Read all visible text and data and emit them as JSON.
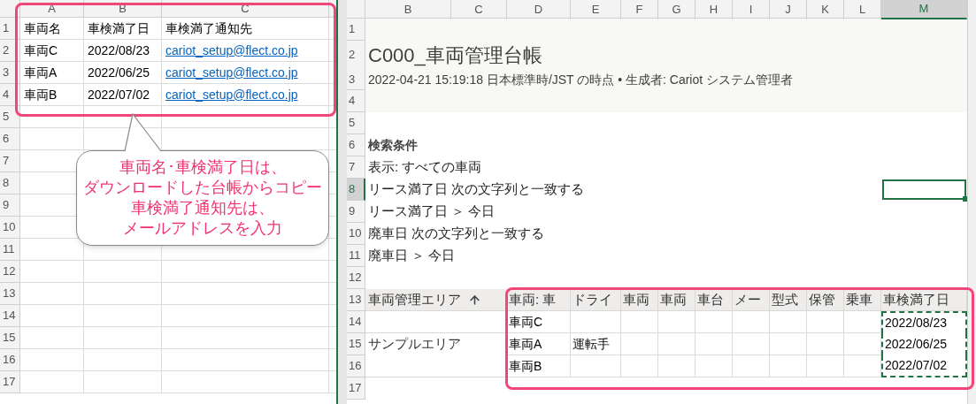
{
  "left_sheet": {
    "columns": [
      "A",
      "B",
      "C"
    ],
    "rows": [
      {
        "number": "1",
        "cells": [
          {
            "text": "車両名",
            "kind": "text"
          },
          {
            "text": "車検満了日",
            "kind": "text"
          },
          {
            "text": "車検満了通知先",
            "kind": "text"
          }
        ]
      },
      {
        "number": "2",
        "cells": [
          {
            "text": "車両C",
            "kind": "text"
          },
          {
            "text": "2022/08/23",
            "kind": "text"
          },
          {
            "text": "cariot_setup@flect.co.jp",
            "kind": "link"
          }
        ]
      },
      {
        "number": "3",
        "cells": [
          {
            "text": "車両A",
            "kind": "text"
          },
          {
            "text": "2022/06/25",
            "kind": "text"
          },
          {
            "text": "cariot_setup@flect.co.jp",
            "kind": "link"
          }
        ]
      },
      {
        "number": "4",
        "cells": [
          {
            "text": "車両B",
            "kind": "text"
          },
          {
            "text": "2022/07/02",
            "kind": "text"
          },
          {
            "text": "cariot_setup@flect.co.jp",
            "kind": "link"
          }
        ]
      },
      {
        "number": "5"
      },
      {
        "number": "6"
      },
      {
        "number": "7"
      },
      {
        "number": "8"
      },
      {
        "number": "9"
      },
      {
        "number": "10"
      },
      {
        "number": "11"
      },
      {
        "number": "12"
      },
      {
        "number": "13"
      },
      {
        "number": "14"
      },
      {
        "number": "15"
      },
      {
        "number": "16"
      },
      {
        "number": "17"
      }
    ]
  },
  "callout": {
    "lines": [
      "車両名･車検満了日は、",
      "ダウンロードした台帳からコピー",
      "車検満了通知先は、",
      "メールアドレスを入力"
    ]
  },
  "right_sheet": {
    "columns": [
      {
        "letter": "B",
        "selected": false
      },
      {
        "letter": "C",
        "selected": false
      },
      {
        "letter": "D",
        "selected": false
      },
      {
        "letter": "E",
        "selected": false
      },
      {
        "letter": "F",
        "selected": false
      },
      {
        "letter": "G",
        "selected": false
      },
      {
        "letter": "H",
        "selected": false
      },
      {
        "letter": "I",
        "selected": false
      },
      {
        "letter": "J",
        "selected": false
      },
      {
        "letter": "K",
        "selected": false
      },
      {
        "letter": "L",
        "selected": false
      },
      {
        "letter": "M",
        "selected": true
      }
    ],
    "expiry_copied": true,
    "rows": [
      {
        "number": "1",
        "selected": false,
        "kind": "blank"
      },
      {
        "number": "2",
        "selected": false,
        "kind": "title",
        "text": "C000_車両管理台帳"
      },
      {
        "number": "3",
        "selected": false,
        "kind": "subtitle",
        "text": "2022-04-21 15:19:18 日本標準時/JST の時点 • 生成者: Cariot システム管理者"
      },
      {
        "number": "4",
        "selected": false,
        "kind": "blank"
      },
      {
        "number": "5",
        "selected": false,
        "kind": "blank"
      },
      {
        "number": "6",
        "selected": false,
        "kind": "heading",
        "text": "検索条件"
      },
      {
        "number": "7",
        "selected": false,
        "kind": "criterion",
        "text": "表示: すべての車両"
      },
      {
        "number": "8",
        "selected": true,
        "kind": "criterion",
        "text": "リース満了日 次の文字列と一致する"
      },
      {
        "number": "9",
        "selected": false,
        "kind": "criterion",
        "text": "リース満了日 ＞ 今日"
      },
      {
        "number": "10",
        "selected": false,
        "kind": "criterion",
        "text": "廃車日 次の文字列と一致する"
      },
      {
        "number": "11",
        "selected": false,
        "kind": "criterion",
        "text": "廃車日 ＞ 今日"
      },
      {
        "number": "12",
        "selected": false,
        "kind": "blank"
      },
      {
        "number": "13",
        "selected": false,
        "kind": "table_header",
        "area": "車両管理エリア",
        "cells": [
          "車両: 車",
          "ドライ",
          "車両",
          "車両",
          "車台",
          "メー",
          "型式",
          "保管",
          "乗車",
          "車検満了日"
        ]
      },
      {
        "number": "14",
        "selected": false,
        "kind": "table_row",
        "vehicle": "車両C",
        "expiry_date": "2022/08/23"
      },
      {
        "number": "15",
        "selected": false,
        "kind": "table_row",
        "area": "サンプルエリア",
        "vehicle": "車両A",
        "driver": "運転手",
        "expiry_date": "2022/06/25"
      },
      {
        "number": "16",
        "selected": false,
        "kind": "table_row",
        "vehicle": "車両B",
        "expiry_date": "2022/07/02"
      },
      {
        "number": "17",
        "selected": false,
        "kind": "blank"
      }
    ]
  }
}
